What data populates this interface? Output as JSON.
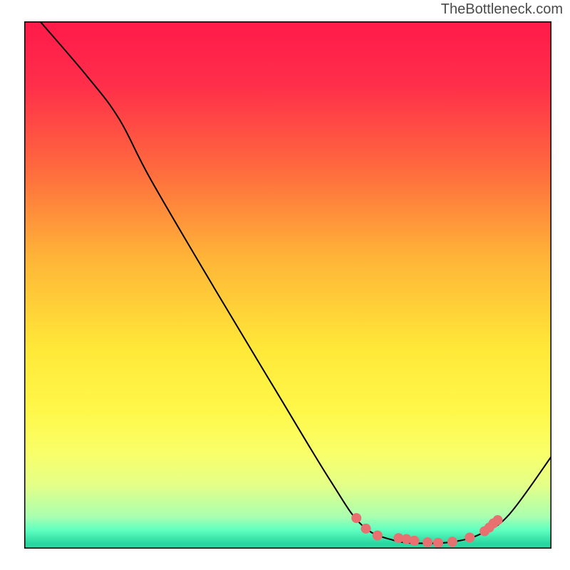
{
  "attribution": "TheBottleneck.com",
  "chart_data": {
    "type": "line",
    "title": "",
    "xlabel": "",
    "ylabel": "",
    "xlim": [
      0,
      100
    ],
    "ylim": [
      0,
      100
    ],
    "gradient_stops": [
      {
        "offset": 0.0,
        "color": "#ff1a4a"
      },
      {
        "offset": 0.12,
        "color": "#ff2e4a"
      },
      {
        "offset": 0.28,
        "color": "#ff6a3e"
      },
      {
        "offset": 0.45,
        "color": "#ffb538"
      },
      {
        "offset": 0.62,
        "color": "#ffe838"
      },
      {
        "offset": 0.74,
        "color": "#fff84a"
      },
      {
        "offset": 0.82,
        "color": "#f9ff6a"
      },
      {
        "offset": 0.88,
        "color": "#e4ff88"
      },
      {
        "offset": 0.94,
        "color": "#a8ffb0"
      },
      {
        "offset": 0.965,
        "color": "#5effc0"
      },
      {
        "offset": 0.99,
        "color": "#2ad7a0"
      },
      {
        "offset": 1.0,
        "color": "#2ad7a0"
      }
    ],
    "curve": [
      {
        "x": 3.0,
        "y": 100.0
      },
      {
        "x": 12.0,
        "y": 89.5
      },
      {
        "x": 18.0,
        "y": 81.5
      },
      {
        "x": 24.0,
        "y": 70.0
      },
      {
        "x": 36.0,
        "y": 49.5
      },
      {
        "x": 48.0,
        "y": 29.5
      },
      {
        "x": 58.0,
        "y": 13.0
      },
      {
        "x": 64.0,
        "y": 4.5
      },
      {
        "x": 70.0,
        "y": 1.6
      },
      {
        "x": 76.0,
        "y": 1.0
      },
      {
        "x": 82.0,
        "y": 1.4
      },
      {
        "x": 87.0,
        "y": 3.0
      },
      {
        "x": 92.0,
        "y": 6.5
      },
      {
        "x": 100.0,
        "y": 17.5
      }
    ],
    "markers": [
      {
        "x": 63.0,
        "y": 5.8
      },
      {
        "x": 64.8,
        "y": 3.8
      },
      {
        "x": 67.0,
        "y": 2.5
      },
      {
        "x": 71.0,
        "y": 2.0
      },
      {
        "x": 72.5,
        "y": 1.8
      },
      {
        "x": 74.0,
        "y": 1.5
      },
      {
        "x": 76.5,
        "y": 1.2
      },
      {
        "x": 78.5,
        "y": 1.1
      },
      {
        "x": 81.2,
        "y": 1.3
      },
      {
        "x": 84.5,
        "y": 2.1
      },
      {
        "x": 87.3,
        "y": 3.3
      },
      {
        "x": 88.2,
        "y": 4.0
      },
      {
        "x": 89.0,
        "y": 4.8
      },
      {
        "x": 89.8,
        "y": 5.4
      }
    ],
    "marker_color": "#e87070",
    "curve_color": "#000000",
    "frame_color": "#000000"
  }
}
